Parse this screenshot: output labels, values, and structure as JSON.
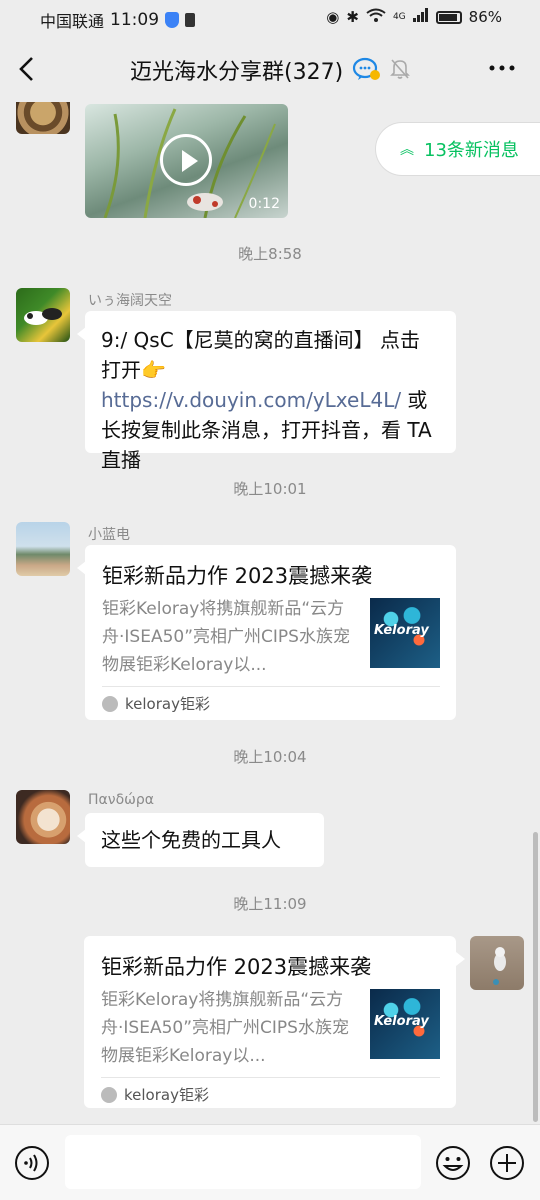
{
  "status_bar": {
    "carrier": "中国联通",
    "time": "11:09",
    "network": "4G",
    "battery": "86%"
  },
  "header": {
    "title": "迈光海水分享群(327)"
  },
  "new_messages": {
    "label": "13条新消息"
  },
  "video_message": {
    "duration": "0:12"
  },
  "messages": [
    {
      "time": "晚上8:58",
      "sender": "いぅ海阔天空",
      "text_a": "9:/ QsC【尼莫的窝的直播间】 点击打开👉",
      "link": "https://v.douyin.com/yLxeL4L/",
      "text_b": " 或长按复制此条消息，打开抖音，看 TA 直播"
    },
    {
      "time": "晚上10:01",
      "sender": "小蓝电",
      "card": {
        "title": "钜彩新品力作 2023震撼来袭",
        "desc": "钜彩Keloray将携旗舰新品“云方舟·ISEA50”亮相广州CIPS水族宠物展钜彩Keloray以...",
        "thumb_text": "Keloray",
        "source": "keloray钜彩"
      }
    },
    {
      "time": "晚上10:04",
      "sender": "Πανδώρα",
      "text": "这些个免费的工具人"
    },
    {
      "time": "晚上11:09",
      "card": {
        "title": "钜彩新品力作 2023震撼来袭",
        "desc": "钜彩Keloray将携旗舰新品“云方舟·ISEA50”亮相广州CIPS水族宠物展钜彩Keloray以...",
        "thumb_text": "Keloray",
        "source": "keloray钜彩"
      }
    }
  ],
  "colors": {
    "background": "#ededed",
    "accent_green": "#07c160",
    "link": "#576b95",
    "bubble": "#ffffff"
  },
  "icons": [
    "back-icon",
    "chat-bubble-icon",
    "mute-icon",
    "more-icon",
    "voice-icon",
    "emoji-icon",
    "plus-icon",
    "play-icon"
  ]
}
